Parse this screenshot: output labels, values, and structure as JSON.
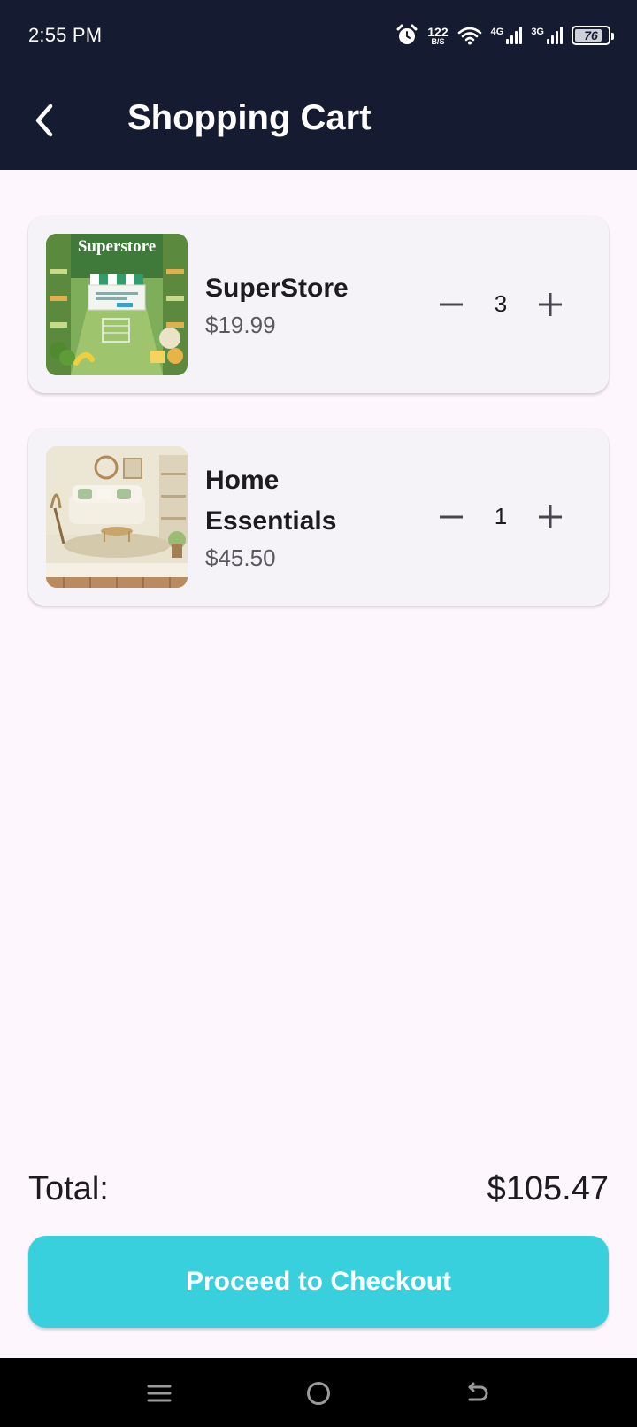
{
  "status_bar": {
    "time": "2:55 PM",
    "net_speed_value": "122",
    "net_speed_unit": "B/S",
    "network_1": "4G",
    "network_2": "3G",
    "battery_percent": "76",
    "icons": [
      "alarm-icon",
      "wifi-icon",
      "signal-icon",
      "signal-icon",
      "battery-icon"
    ]
  },
  "app_bar": {
    "title": "Shopping Cart",
    "back_icon": "chevron-left-icon"
  },
  "cart": {
    "items": [
      {
        "name": "SuperStore",
        "price": "$19.99",
        "quantity": "3",
        "image_text": "Superstore"
      },
      {
        "name": "Home Essentials",
        "price": "$45.50",
        "quantity": "1"
      }
    ],
    "decrement_icon": "minus-icon",
    "increment_icon": "plus-icon"
  },
  "summary": {
    "total_label": "Total:",
    "total_value": "$105.47"
  },
  "checkout": {
    "label": "Proceed to Checkout"
  },
  "colors": {
    "header_bg": "#151b31",
    "page_bg": "#fdf7fd",
    "card_bg": "#f5f3f8",
    "accent": "#37d0dc"
  },
  "nav_bar": {
    "icons": [
      "menu-icon",
      "home-icon",
      "back-icon"
    ]
  }
}
